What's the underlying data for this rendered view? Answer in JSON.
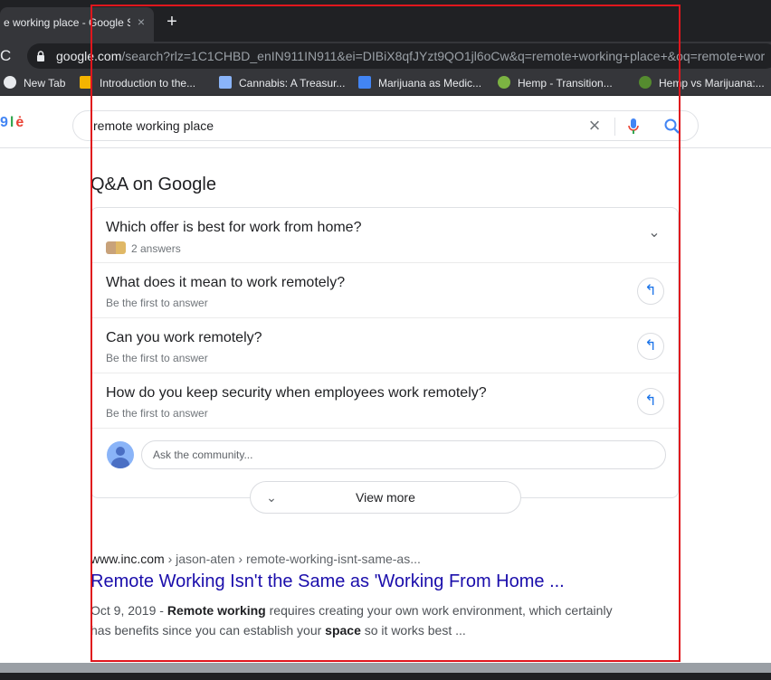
{
  "browser": {
    "tab_title": "e working place - Google S",
    "tab_close": "×",
    "new_tab": "+",
    "reload_glyph": "C",
    "url_domain": "google.com",
    "url_path": "/search?rlz=1C1CHBD_enIN911IN911&ei=DIBiX8qfJYzt9QO1jl6oCw&q=remote+working+place+&oq=remote+wor"
  },
  "bookmarks": [
    {
      "label": "New Tab",
      "icon": "globe-icon",
      "color": "#e8eaed"
    },
    {
      "label": "Introduction to the...",
      "icon": "drive-icon",
      "color": "#f4b400"
    },
    {
      "label": "Cannabis: A Treasur...",
      "icon": "tag-icon",
      "color": "#8ab4f8"
    },
    {
      "label": "Marijuana as Medic...",
      "icon": "tag-icon",
      "color": "#4285f4"
    },
    {
      "label": "Hemp - Transition...",
      "icon": "leaf-icon",
      "color": "#7cb342"
    },
    {
      "label": "Hemp vs Marijuana:...",
      "icon": "leaf-icon",
      "color": "#558b2f"
    }
  ],
  "search": {
    "query": "remote working place",
    "clear": "×"
  },
  "qa": {
    "title": "Q&A on Google",
    "questions": [
      {
        "question": "Which offer is best for work from home?",
        "sub": "2 answers",
        "action": "⌄"
      },
      {
        "question": "What does it mean to work remotely?",
        "sub": "Be the first to answer",
        "action": "↰"
      },
      {
        "question": "Can you work remotely?",
        "sub": "Be the first to answer",
        "action": "↰"
      },
      {
        "question": "How do you keep security when employees work remotely?",
        "sub": "Be the first to answer",
        "action": "↰"
      }
    ],
    "ask_placeholder": "Ask the community...",
    "view_more": "View more",
    "view_more_chev": "⌄"
  },
  "result": {
    "cite_domain": "www.inc.com",
    "cite_path": " › jason-aten › remote-working-isnt-same-as...",
    "title": "Remote Working Isn't the Same as 'Working From Home ...",
    "date": "Oct 9, 2019 - ",
    "snippet_b1": "Remote working",
    "snippet_t1": " requires creating your own work environment, which certainly has benefits since you can establish your ",
    "snippet_b2": "space",
    "snippet_t2": " so it works best ..."
  },
  "colors": {
    "annotation_frame": "#e0161d",
    "link": "#1a0dab",
    "accent": "#1a73e8"
  }
}
